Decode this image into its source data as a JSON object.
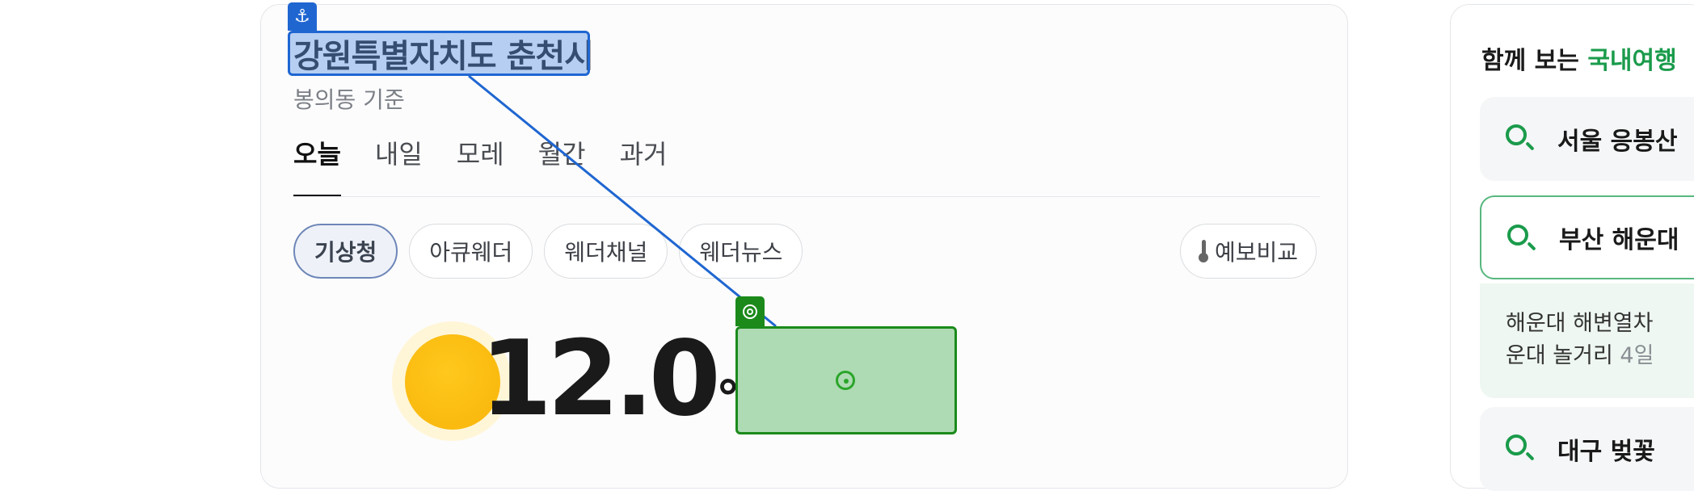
{
  "weather": {
    "location": "강원특별자치도 춘천시",
    "sub": "봉의동 기준",
    "tabs": [
      "오늘",
      "내일",
      "모레",
      "월간",
      "과거"
    ],
    "sources": [
      "기상청",
      "아큐웨더",
      "웨더채널",
      "웨더뉴스"
    ],
    "compare_label": "예보비교",
    "temperature": "12.0",
    "degree": "°"
  },
  "related": {
    "title_prefix": "함께 보는",
    "title_highlight": "국내여행",
    "items": [
      "서울 응봉산",
      "부산 해운대",
      "대구 벚꽃"
    ],
    "snippet_line1": "해운대 해변열차",
    "snippet_line2": "운대 놀거리",
    "snippet_age": "4일"
  },
  "annotation": {
    "source_icon": "anchor-icon",
    "target_icon": "target-icon",
    "source_color": "#1f66d1",
    "target_color": "#1b8a1b"
  }
}
